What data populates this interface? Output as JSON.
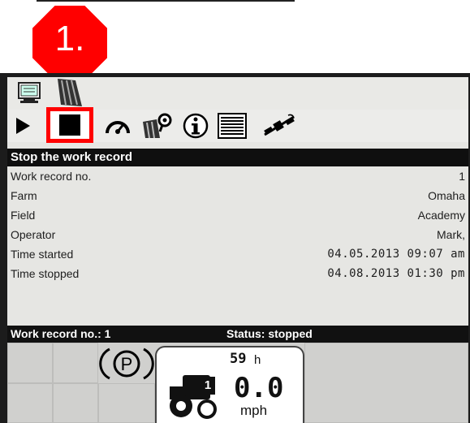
{
  "step": {
    "label": "1."
  },
  "colors": {
    "badge": "#ff0000",
    "highlight": "#ff0000",
    "bar": "#0f0f0f"
  },
  "icons": {
    "top": [
      "monitor-icon",
      "field-map-icon"
    ],
    "toolbar": [
      "play-icon",
      "stop-icon",
      "speedometer-icon",
      "field-pin-icon",
      "info-icon",
      "list-icon",
      "satellite-icon"
    ]
  },
  "toolbar": {
    "selected": "stop-icon"
  },
  "panel": {
    "title": "Stop the work record"
  },
  "record": {
    "rows": [
      {
        "label": "Work record no.",
        "value": "1"
      },
      {
        "label": "Farm",
        "value": "Omaha"
      },
      {
        "label": "Field",
        "value": "Academy"
      },
      {
        "label": "Operator",
        "value": "Mark,"
      },
      {
        "label": "Time started",
        "value": "04.05.2013 09:07 am"
      },
      {
        "label": "Time stopped",
        "value": "04.08.2013 01:30 pm"
      }
    ]
  },
  "status": {
    "record": "Work record no.: 1",
    "state": "Status: stopped"
  },
  "dashboard": {
    "parking_brake": "P",
    "hours": "59",
    "hours_unit": "h",
    "gear": "1",
    "speed": "0.0",
    "speed_unit": "mph"
  }
}
